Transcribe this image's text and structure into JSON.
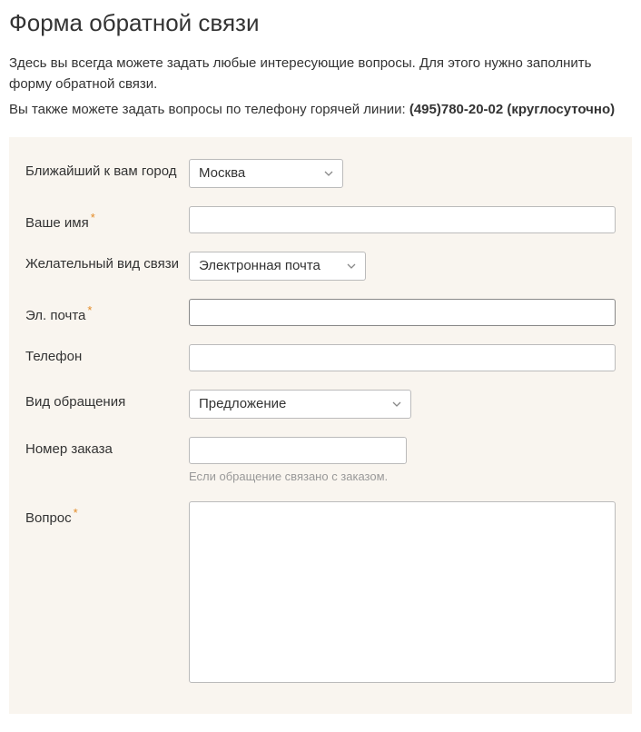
{
  "header": {
    "title": "Форма обратной связи",
    "intro1": "Здесь вы всегда можете задать любые интересующие вопросы. Для этого нужно заполнить форму обратной связи.",
    "intro2_prefix": "Вы также можете задать вопросы по телефону горячей линии: ",
    "intro2_bold": "(495)780-20-02 (круглосуточно)"
  },
  "form": {
    "city": {
      "label": "Ближайший к вам город",
      "value": "Москва"
    },
    "name": {
      "label": "Ваше имя",
      "required_mark": "*",
      "value": ""
    },
    "contact_method": {
      "label": "Желательный вид связи",
      "value": "Электронная почта"
    },
    "email": {
      "label": "Эл. почта",
      "required_mark": "*",
      "value": ""
    },
    "phone": {
      "label": "Телефон",
      "value": ""
    },
    "request_type": {
      "label": "Вид обращения",
      "value": "Предложение"
    },
    "order": {
      "label": "Номер заказа",
      "value": "",
      "hint": "Если обращение связано с заказом."
    },
    "question": {
      "label": "Вопрос",
      "required_mark": "*",
      "value": ""
    }
  }
}
